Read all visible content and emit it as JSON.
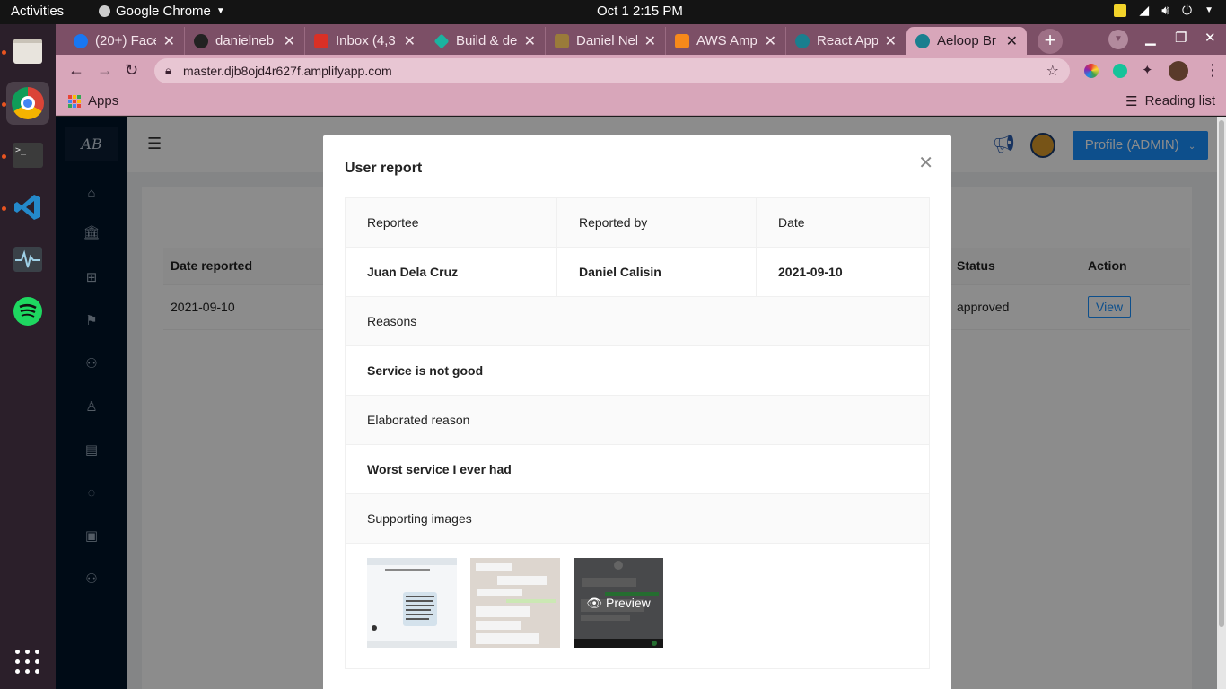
{
  "system": {
    "activities": "Activities",
    "app_name": "Google Chrome",
    "clock": "Oct 1   2:15 PM"
  },
  "browser": {
    "tabs": [
      {
        "label": "(20+) Facel",
        "icon_color": "#1877f2"
      },
      {
        "label": "danielneb",
        "icon_color": "#222222"
      },
      {
        "label": "Inbox (4,3",
        "icon_color": "#d93025"
      },
      {
        "label": "Build & de",
        "icon_color": "#1ab3a0"
      },
      {
        "label": "Daniel Nel",
        "icon_color": "#9a7b3a"
      },
      {
        "label": "AWS Amp",
        "icon_color": "#f7891a"
      },
      {
        "label": "React App",
        "icon_color": "#1a7f8f"
      },
      {
        "label": "Aeloop Br",
        "icon_color": "#1a7f8f"
      }
    ],
    "url": "master.djb8ojd4r627f.amplifyapp.com",
    "bookmarks": {
      "apps": "Apps",
      "reading_list": "Reading list"
    }
  },
  "app": {
    "logo": "AB",
    "profile_button": "Profile (ADMIN)",
    "table": {
      "headers": {
        "date_reported": "Date reported",
        "status": "Status",
        "action": "Action"
      },
      "row": {
        "date_reported": "2021-09-10",
        "status": "approved",
        "action": "View"
      }
    }
  },
  "modal": {
    "title": "User report",
    "reportee_label": "Reportee",
    "reported_by_label": "Reported by",
    "date_label": "Date",
    "reportee": "Juan Dela Cruz",
    "reported_by": "Daniel Calisin",
    "date": "2021-09-10",
    "reasons_label": "Reasons",
    "reasons": "Service is not good",
    "elaborated_label": "Elaborated reason",
    "elaborated": "Worst service I ever had",
    "images_label": "Supporting images",
    "preview_label": "Preview"
  },
  "colors": {
    "primary": "#1890ff",
    "sidebar": "#001529",
    "chrome_tab": "#d8a6ba"
  }
}
